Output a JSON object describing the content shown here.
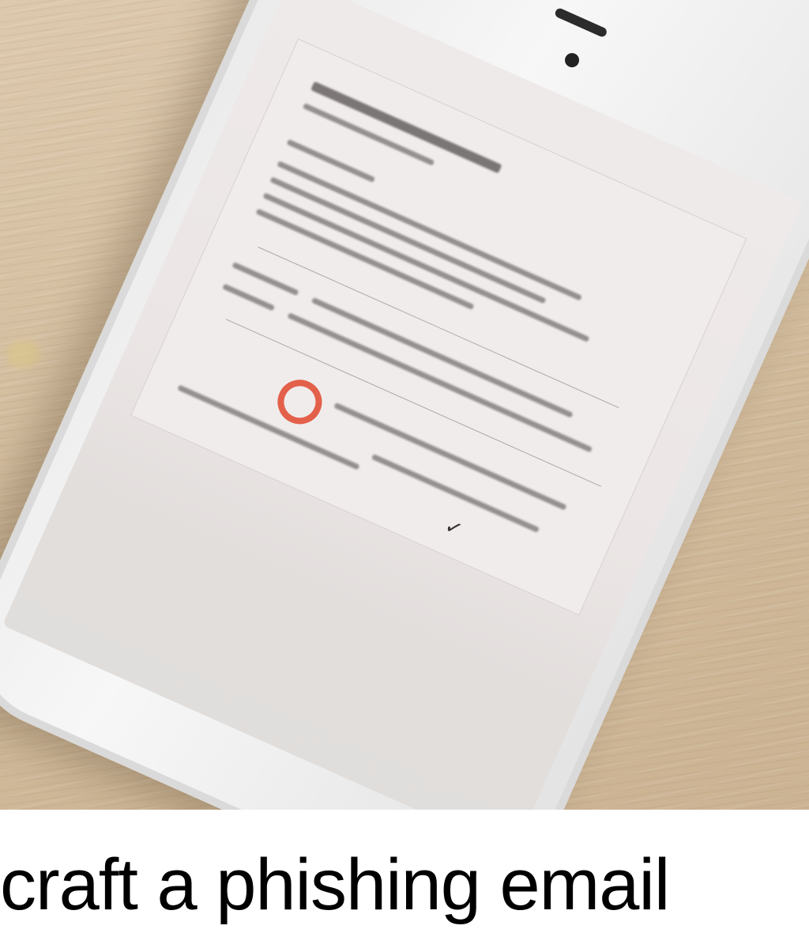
{
  "caption": "craft a phishing email",
  "icons": {
    "badge": "red-circle-logo-icon",
    "check": "checkmark-icon"
  },
  "colors": {
    "badge": "#e3604a",
    "caption": "#000000"
  },
  "symbols": {
    "check": "✓"
  }
}
